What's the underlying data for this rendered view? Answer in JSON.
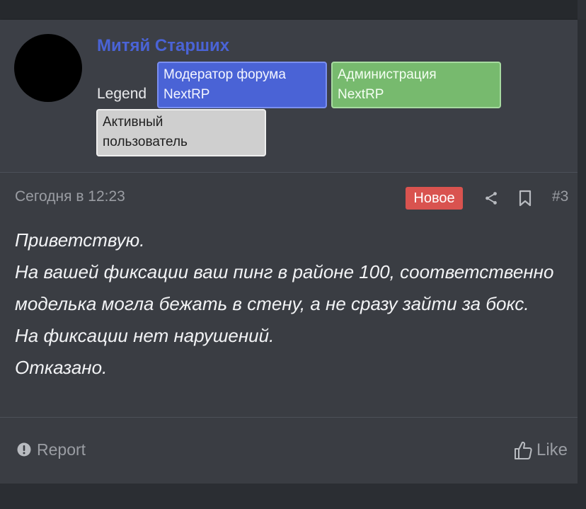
{
  "author": {
    "username": "Митяй Старших",
    "legend_label": "Legend",
    "badges": [
      {
        "label": "Модератор форума\nNextRP",
        "color": "#4a63d6"
      },
      {
        "label": "Администрация\nNextRP",
        "color": "#77ba6e"
      },
      {
        "label": "Активный\nпользователь",
        "color": "#cfcfcf"
      }
    ]
  },
  "meta": {
    "timestamp": "Сегодня в 12:23",
    "new_badge": "Новое",
    "new_badge_color": "#d9534f",
    "share_icon": "share-icon",
    "bookmark_icon": "bookmark-icon",
    "post_number": "#3"
  },
  "message": {
    "lines": [
      "Приветствую.",
      "На вашей фиксации ваш пинг в районе 100, соответственно моделька могла бежать в стену, а не сразу зайти за бокс.",
      "На фиксации нет нарушений.",
      "Отказано."
    ]
  },
  "footer": {
    "report_icon": "alert-circle-icon",
    "report_label": "Report",
    "like_icon": "thumbs-up-icon",
    "like_label": "Like"
  }
}
